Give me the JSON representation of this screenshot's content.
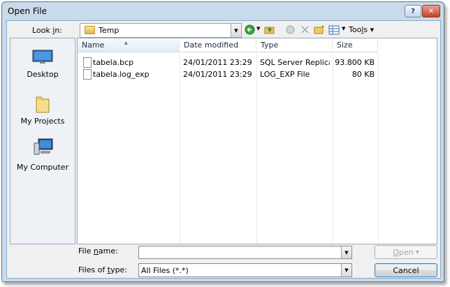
{
  "window": {
    "title": "Open File",
    "help_glyph": "?",
    "close_glyph": "✕"
  },
  "look_in": {
    "label_pre": "Look ",
    "label_ul": "i",
    "label_post": "n:",
    "value": "Temp"
  },
  "toolbar": {
    "tools_label_pre": "Too",
    "tools_label_ul": "l",
    "tools_label_post": "s"
  },
  "places": [
    {
      "label": "Desktop",
      "icon": "desktop-icon"
    },
    {
      "label": "My Projects",
      "icon": "folder-icon"
    },
    {
      "label": "My Computer",
      "icon": "computer-icon"
    }
  ],
  "list": {
    "columns": [
      "Name",
      "Date modified",
      "Type",
      "Size"
    ],
    "rows": [
      {
        "name": "tabela.bcp",
        "date": "24/01/2011 23:29",
        "type": "SQL Server Replica...",
        "size": "93.800 KB"
      },
      {
        "name": "tabela.log_exp",
        "date": "24/01/2011 23:29",
        "type": "LOG_EXP File",
        "size": "80 KB"
      }
    ]
  },
  "file_name": {
    "label_pre": "File ",
    "label_ul": "n",
    "label_post": "ame:",
    "value": ""
  },
  "file_type": {
    "label_pre": "Files of ",
    "label_ul": "t",
    "label_post": "ype:",
    "value": "All Files (*.*)"
  },
  "buttons": {
    "open_ul": "O",
    "open_rest": "pen",
    "cancel": "Cancel"
  },
  "colors": {
    "window_frame": "#c9daea",
    "client_bg": "#f0f0f0"
  }
}
